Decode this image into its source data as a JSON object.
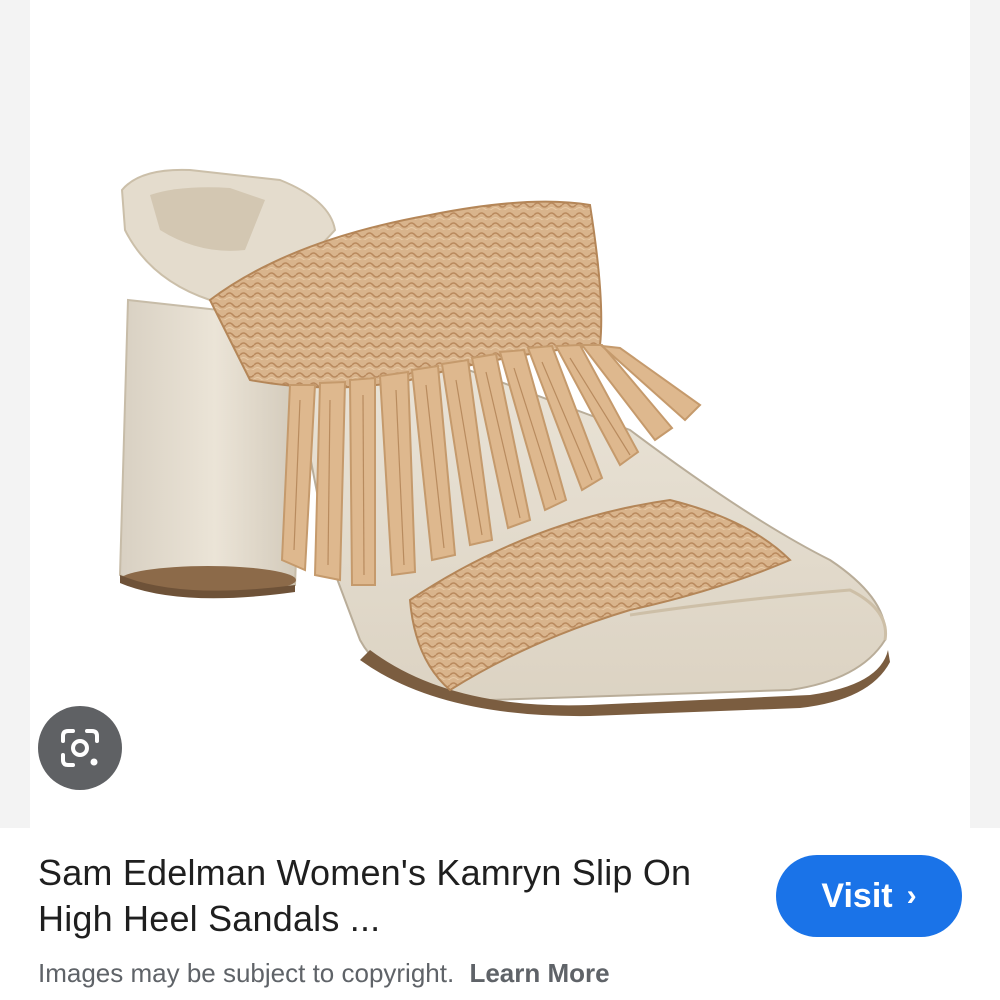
{
  "result": {
    "title_line1": "Sam Edelman Women's Kamryn Slip On",
    "title_line2": "High Heel Sandals ...",
    "visit_label": "Visit",
    "visit_chevron": "›"
  },
  "footer": {
    "copyright_text": "Images may be subject to copyright.",
    "learn_more_label": "Learn More"
  },
  "icons": {
    "lens": "google-lens-icon"
  },
  "colors": {
    "accent": "#1a73e8",
    "lens_bg": "#5f6164",
    "title": "#1f1f1f",
    "muted": "#5f6368"
  }
}
